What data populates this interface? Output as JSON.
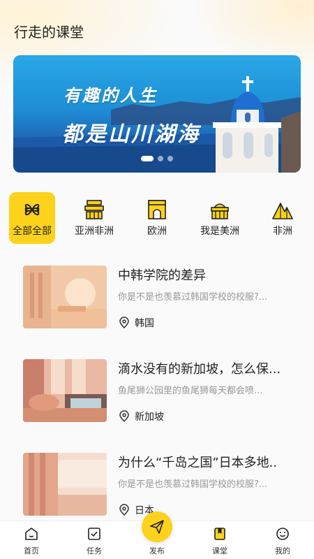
{
  "header": {
    "title": "行走的课堂"
  },
  "banner": {
    "line1": "有趣的人生",
    "line2": "都是山川湖海",
    "active_dot": 0,
    "dot_count": 3
  },
  "categories": [
    {
      "label": "全部全部",
      "icon": "clover-icon",
      "active": true
    },
    {
      "label": "亚洲非洲",
      "icon": "temple-icon",
      "active": false
    },
    {
      "label": "欧洲",
      "icon": "arch-icon",
      "active": false
    },
    {
      "label": "我是美洲",
      "icon": "building-icon",
      "active": false
    },
    {
      "label": "非洲",
      "icon": "mountain-icon",
      "active": false
    }
  ],
  "courses": [
    {
      "title": "中韩学院的差异",
      "desc": "你是不是也羡慕过韩国学校的校服?...",
      "location": "韩国"
    },
    {
      "title": "滴水没有的新加坡，怎么保...",
      "desc": "鱼尾狮公园里的鱼尾狮每天都会喷...",
      "location": "新加坡"
    },
    {
      "title": "为什么“千岛之国”日本多地..",
      "desc": "你是不是也羡慕过韩国学校的校服?...",
      "location": "日本"
    }
  ],
  "tabbar": {
    "home": "首页",
    "tasks": "任务",
    "publish": "发布",
    "classroom": "课堂",
    "mine": "我的"
  },
  "colors": {
    "accent": "#fcd21a",
    "text_muted": "#999999"
  }
}
